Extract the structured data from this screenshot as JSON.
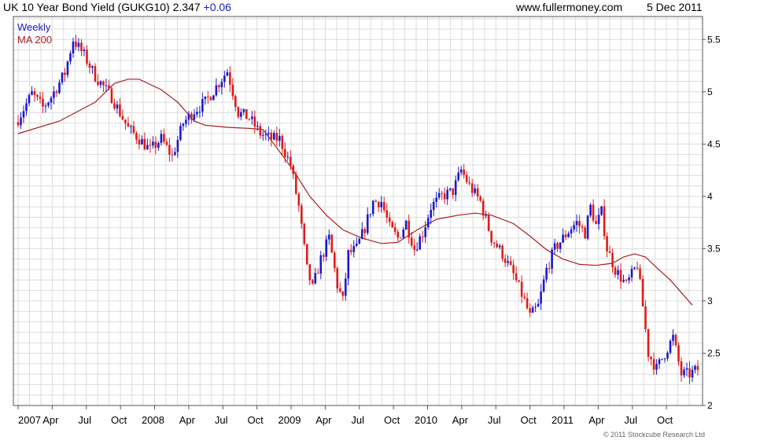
{
  "header": {
    "title": "UK 10 Year Bond Yield (GUKG10)",
    "last": "2.347",
    "change": "+0.06",
    "site": "www.fullermoney.com",
    "date": "5 Dec 2011"
  },
  "legend": {
    "line1": "Weekly",
    "line2": "MA 200"
  },
  "footer": "© 2011 Stockcube Research Ltd",
  "colors": {
    "up": "#1a1acc",
    "down": "#e01b1b",
    "ma": "#a81f1f",
    "grid": "#dcdcdc",
    "axis": "#555555"
  },
  "chart_data": {
    "type": "candlestick",
    "title": "UK 10 Year Bond Yield (GUKG10)",
    "frequency": "Weekly",
    "x_range": [
      "2007-01",
      "2011-12"
    ],
    "ylim": [
      2.0,
      5.72
    ],
    "y_ticks": [
      "2",
      "2.5",
      "3",
      "3.5",
      "4",
      "4.5",
      "5",
      "5.5"
    ],
    "x_ticks": [
      "2007",
      "Apr",
      "Jul",
      "Oct",
      "2008",
      "Apr",
      "Jul",
      "Oct",
      "2009",
      "Apr",
      "Jul",
      "Oct",
      "2010",
      "Apr",
      "Jul",
      "Oct",
      "2011",
      "Apr",
      "Jul",
      "Oct"
    ],
    "grid": true,
    "series": [
      {
        "name": "Weekly",
        "close_anchors": [
          [
            0,
            4.74
          ],
          [
            5,
            4.98
          ],
          [
            9,
            4.85
          ],
          [
            12,
            4.95
          ],
          [
            17,
            5.18
          ],
          [
            20,
            5.5
          ],
          [
            24,
            5.35
          ],
          [
            28,
            5.15
          ],
          [
            34,
            4.95
          ],
          [
            40,
            4.65
          ],
          [
            44,
            4.55
          ],
          [
            48,
            4.44
          ],
          [
            52,
            4.55
          ],
          [
            56,
            4.38
          ],
          [
            60,
            4.7
          ],
          [
            64,
            4.82
          ],
          [
            68,
            4.9
          ],
          [
            72,
            5.05
          ],
          [
            76,
            5.2
          ],
          [
            80,
            4.8
          ],
          [
            84,
            4.75
          ],
          [
            88,
            4.6
          ],
          [
            92,
            4.55
          ],
          [
            95,
            4.55
          ],
          [
            99,
            4.3
          ],
          [
            102,
            3.9
          ],
          [
            105,
            3.3
          ],
          [
            107,
            3.12
          ],
          [
            110,
            3.4
          ],
          [
            113,
            3.6
          ],
          [
            116,
            3.15
          ],
          [
            118,
            3.0
          ],
          [
            120,
            3.45
          ],
          [
            123,
            3.5
          ],
          [
            126,
            3.7
          ],
          [
            129,
            3.95
          ],
          [
            132,
            3.95
          ],
          [
            135,
            3.7
          ],
          [
            138,
            3.6
          ],
          [
            141,
            3.75
          ],
          [
            144,
            3.5
          ],
          [
            147,
            3.65
          ],
          [
            150,
            3.9
          ],
          [
            154,
            4.0
          ],
          [
            158,
            4.05
          ],
          [
            161,
            4.25
          ],
          [
            164,
            4.1
          ],
          [
            168,
            3.95
          ],
          [
            172,
            3.6
          ],
          [
            176,
            3.45
          ],
          [
            180,
            3.25
          ],
          [
            184,
            3.0
          ],
          [
            186,
            2.85
          ],
          [
            189,
            2.95
          ],
          [
            192,
            3.3
          ],
          [
            195,
            3.5
          ],
          [
            198,
            3.6
          ],
          [
            201,
            3.7
          ],
          [
            203,
            3.75
          ],
          [
            206,
            3.65
          ],
          [
            208,
            3.9
          ],
          [
            210,
            3.72
          ],
          [
            212,
            3.85
          ],
          [
            214,
            3.5
          ],
          [
            217,
            3.3
          ],
          [
            221,
            3.15
          ],
          [
            225,
            3.35
          ],
          [
            227,
            2.95
          ],
          [
            229,
            2.5
          ],
          [
            232,
            2.35
          ],
          [
            235,
            2.5
          ],
          [
            238,
            2.65
          ],
          [
            241,
            2.3
          ],
          [
            244,
            2.3
          ],
          [
            247,
            2.347
          ]
        ]
      },
      {
        "name": "MA 200",
        "points": [
          [
            0,
            4.6
          ],
          [
            15,
            4.72
          ],
          [
            28,
            4.9
          ],
          [
            35,
            5.08
          ],
          [
            40,
            5.12
          ],
          [
            44,
            5.12
          ],
          [
            52,
            5.02
          ],
          [
            58,
            4.9
          ],
          [
            64,
            4.72
          ],
          [
            68,
            4.68
          ],
          [
            76,
            4.66
          ],
          [
            84,
            4.65
          ],
          [
            89,
            4.64
          ],
          [
            93,
            4.5
          ],
          [
            100,
            4.25
          ],
          [
            106,
            4.0
          ],
          [
            112,
            3.82
          ],
          [
            118,
            3.68
          ],
          [
            125,
            3.6
          ],
          [
            132,
            3.55
          ],
          [
            138,
            3.56
          ],
          [
            145,
            3.68
          ],
          [
            152,
            3.78
          ],
          [
            160,
            3.82
          ],
          [
            166,
            3.84
          ],
          [
            172,
            3.82
          ],
          [
            180,
            3.74
          ],
          [
            186,
            3.62
          ],
          [
            192,
            3.49
          ],
          [
            198,
            3.4
          ],
          [
            204,
            3.35
          ],
          [
            210,
            3.34
          ],
          [
            216,
            3.36
          ],
          [
            220,
            3.42
          ],
          [
            224,
            3.45
          ],
          [
            228,
            3.42
          ],
          [
            232,
            3.32
          ],
          [
            237,
            3.2
          ],
          [
            242,
            3.05
          ],
          [
            245,
            2.96
          ]
        ]
      }
    ]
  }
}
